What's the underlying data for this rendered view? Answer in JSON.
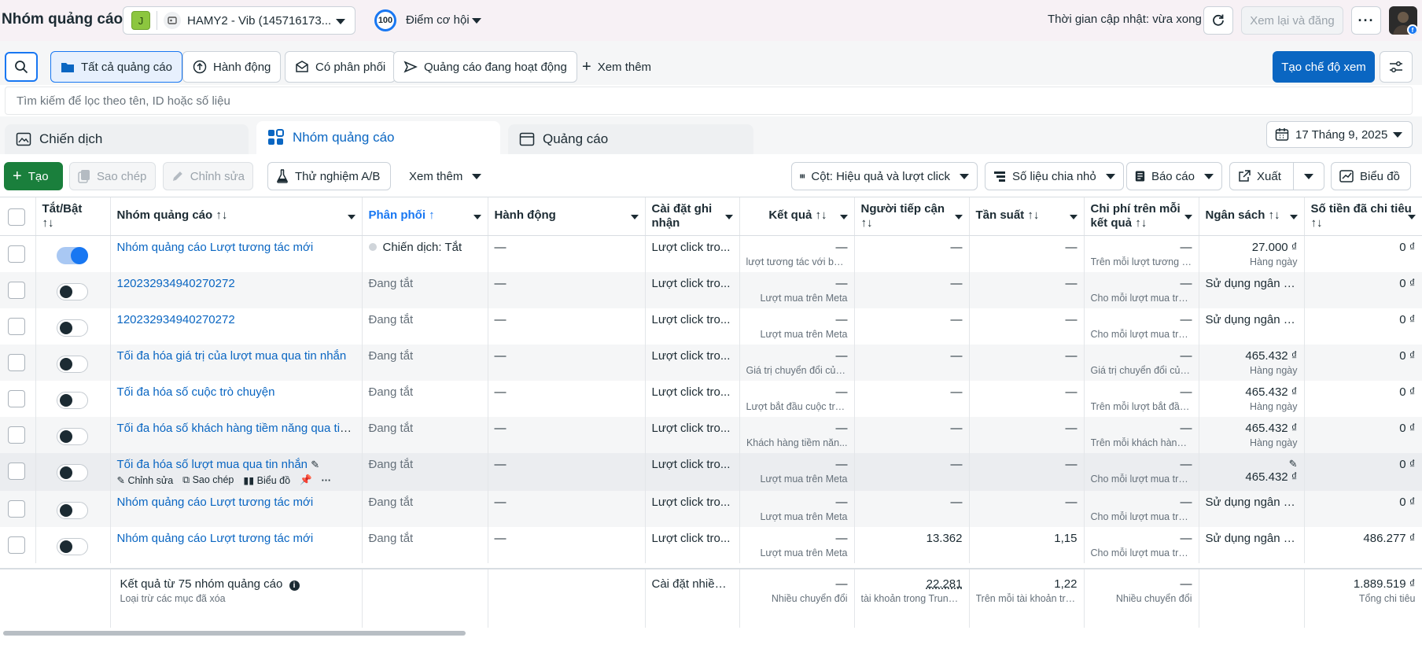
{
  "header": {
    "title": "Nhóm quảng cáo",
    "account_badge": "J",
    "account_name": "HAMY2 - Vib (145716173...",
    "score_value": "100",
    "score_label": "Điểm cơ hội",
    "updated_text": "Thời gian cập nhật: vừa xong",
    "review_button": "Xem lại và đăng",
    "more_icon": "···"
  },
  "filters": {
    "chips": [
      "Tất cả quảng cáo",
      "Hành động",
      "Có phân phối",
      "Quảng cáo đang hoạt động",
      "Xem thêm"
    ],
    "create_view_button": "Tạo chế độ xem",
    "search_placeholder": "Tìm kiếm để lọc theo tên, ID hoặc số liệu"
  },
  "level_tabs": [
    "Chiến dịch",
    "Nhóm quảng cáo",
    "Quảng cáo"
  ],
  "date_range": "17 Tháng 9, 2025",
  "actions": {
    "create": "Tạo",
    "duplicate": "Sao chép",
    "edit": "Chỉnh sửa",
    "ab_test": "Thử nghiệm A/B",
    "more": "Xem thêm",
    "columns": "Cột: Hiệu quả và lượt click",
    "breakdown": "Số liệu chia nhỏ",
    "reports": "Báo cáo",
    "export": "Xuất",
    "charts": "Biểu đồ"
  },
  "table": {
    "headers": {
      "toggle": "Tắt/Bật",
      "name": "Nhóm quảng cáo",
      "delivery": "Phân phối",
      "actions": "Hành động",
      "attribution": "Cài đặt ghi nhận",
      "results": "Kết quả",
      "reach": "Người tiếp cận",
      "frequency": "Tần suất",
      "cost_per_result": "Chi phí trên mỗi kết quả",
      "budget": "Ngân sách",
      "amount_spent": "Số tiền đã chi tiêu"
    },
    "rows": [
      {
        "on": true,
        "name": "Nhóm quảng cáo Lượt tương tác mới",
        "delivery": "Chiến dịch: Tắt",
        "delivery_dot": true,
        "action": "—",
        "attribution": "Lượt click tro...",
        "results": "—",
        "results_sub": "lượt tương tác với bài ...",
        "reach": "—",
        "frequency": "—",
        "cpr": "—",
        "cpr_sub": "Trên mỗi lượt tương t...",
        "budget": "27.000 ₫",
        "budget_sub": "Hàng ngày",
        "spent": "0 ₫"
      },
      {
        "on": false,
        "name": "120232934940270272",
        "delivery": "Đang tắt",
        "action": "—",
        "attribution": "Lượt click tro...",
        "results": "—",
        "results_sub": "Lượt mua trên Meta",
        "reach": "—",
        "frequency": "—",
        "cpr": "—",
        "cpr_sub": "Cho mỗi lượt mua trê...",
        "budget": "Sử dụng ngân s...",
        "budget_sub": "",
        "spent": "0 ₫"
      },
      {
        "on": false,
        "name": "120232934940270272",
        "delivery": "Đang tắt",
        "action": "—",
        "attribution": "Lượt click tro...",
        "results": "—",
        "results_sub": "Lượt mua trên Meta",
        "reach": "—",
        "frequency": "—",
        "cpr": "—",
        "cpr_sub": "Cho mỗi lượt mua trê...",
        "budget": "Sử dụng ngân s...",
        "budget_sub": "",
        "spent": "0 ₫"
      },
      {
        "on": false,
        "name": "Tối đa hóa giá trị của lượt mua qua tin nhắn",
        "delivery": "Đang tắt",
        "action": "—",
        "attribution": "Lượt click tro...",
        "results": "—",
        "results_sub": "Giá trị chuyển đổi của ...",
        "reach": "—",
        "frequency": "—",
        "cpr": "—",
        "cpr_sub": "Giá trị chuyển đổi của ...",
        "budget": "465.432 ₫",
        "budget_sub": "Hàng ngày",
        "spent": "0 ₫"
      },
      {
        "on": false,
        "name": "Tối đa hóa số cuộc trò chuyện",
        "delivery": "Đang tắt",
        "action": "—",
        "attribution": "Lượt click tro...",
        "results": "—",
        "results_sub": "Lượt bắt đầu cuộc trò ...",
        "reach": "—",
        "frequency": "—",
        "cpr": "—",
        "cpr_sub": "Trên mỗi lượt bắt đầu ...",
        "budget": "465.432 ₫",
        "budget_sub": "Hàng ngày",
        "spent": "0 ₫"
      },
      {
        "on": false,
        "name": "Tối đa hóa số khách hàng tiềm năng qua tin n...",
        "delivery": "Đang tắt",
        "action": "—",
        "attribution": "Lượt click tro...",
        "results": "—",
        "results_sub": "Khách hàng tiềm năn...",
        "reach": "—",
        "frequency": "—",
        "cpr": "—",
        "cpr_sub": "Trên mỗi khách hàng t...",
        "budget": "465.432 ₫",
        "budget_sub": "Hàng ngày",
        "spent": "0 ₫"
      },
      {
        "on": false,
        "hover": true,
        "name": "Tối đa hóa số lượt mua qua tin nhắn",
        "delivery": "Đang tắt",
        "action": "—",
        "attribution": "Lượt click tro...",
        "results": "—",
        "results_sub": "Lượt mua trên Meta",
        "reach": "—",
        "frequency": "—",
        "cpr": "—",
        "cpr_sub": "Cho mỗi lượt mua trê...",
        "budget": "465.432 ₫",
        "budget_sub": "",
        "spent": "0 ₫"
      },
      {
        "on": false,
        "name": "Nhóm quảng cáo Lượt tương tác mới",
        "delivery": "Đang tắt",
        "action": "—",
        "attribution": "Lượt click tro...",
        "results": "—",
        "results_sub": "Lượt mua trên Meta",
        "reach": "—",
        "frequency": "—",
        "cpr": "—",
        "cpr_sub": "Cho mỗi lượt mua trê...",
        "budget": "Sử dụng ngân s...",
        "budget_sub": "",
        "spent": "0 ₫"
      },
      {
        "on": false,
        "name": "Nhóm quảng cáo Lượt tương tác mới",
        "delivery": "Đang tắt",
        "action": "—",
        "attribution": "Lượt click tro...",
        "results": "—",
        "results_sub": "Lượt mua trên Meta",
        "reach": "13.362",
        "frequency": "1,15",
        "cpr": "—",
        "cpr_sub": "Cho mỗi lượt mua trê...",
        "budget": "Sử dụng ngân s...",
        "budget_sub": "",
        "spent": "486.277 ₫"
      }
    ],
    "row_actions": {
      "edit": "Chỉnh sửa",
      "duplicate": "Sao chép",
      "chart": "Biểu đồ"
    }
  },
  "footer": {
    "summary": "Kết quả từ 75 nhóm quảng cáo",
    "summary_sub": "Loại trừ các mục đã xóa",
    "attribution": "Cài đặt nhiều ...",
    "results": "—",
    "results_sub": "Nhiều chuyển đổi",
    "reach": "22.281",
    "reach_sub": "tài khoản trong Trung ...",
    "frequency": "1,22",
    "frequency_sub": "Trên mỗi tài khoản tro...",
    "cpr": "—",
    "cpr_sub": "Nhiều chuyển đổi",
    "spent": "1.889.519 ₫",
    "spent_sub": "Tổng chi tiêu"
  }
}
